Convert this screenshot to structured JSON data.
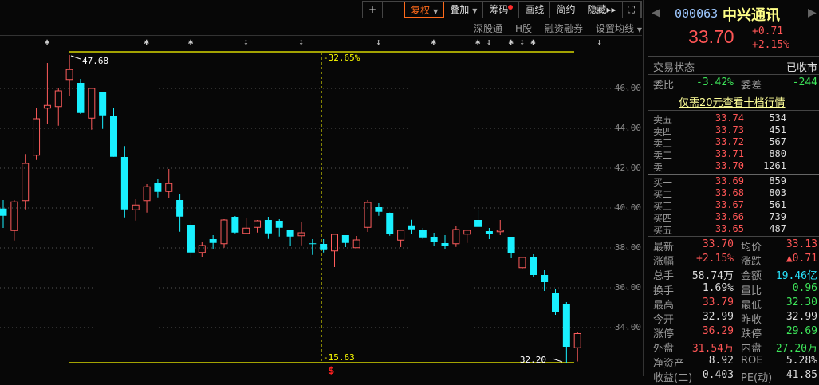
{
  "toolbar": {
    "zoom_in": "+",
    "zoom_out": "—",
    "restore_rights": "复权",
    "overlay": "叠加",
    "chips": "筹码",
    "draw": "画线",
    "simple": "简约",
    "hide": "隐藏",
    "hide_arrow": "▸▸",
    "fullscreen": "⛶"
  },
  "subbar": [
    "深股通",
    "H股",
    "融资融券",
    "设置均线"
  ],
  "events": [
    {
      "x_index": 2,
      "type": "star"
    },
    {
      "x_index": 11,
      "type": "star"
    },
    {
      "x_index": 15,
      "type": "star"
    },
    {
      "x_index": 20,
      "type": "info"
    },
    {
      "x_index": 25,
      "type": "info"
    },
    {
      "x_index": 32,
      "type": "info"
    },
    {
      "x_index": 37,
      "type": "star"
    },
    {
      "x_index": 41,
      "type": "star"
    },
    {
      "x_index": 42,
      "type": "info"
    },
    {
      "x_index": 44,
      "type": "star"
    },
    {
      "x_index": 45,
      "type": "info"
    },
    {
      "x_index": 46,
      "type": "star"
    },
    {
      "x_index": 52,
      "type": "info"
    }
  ],
  "chart_data": {
    "type": "candlestick",
    "ylim": [
      32.0,
      48.0
    ],
    "y_ticks": [
      "46.00",
      "44.00",
      "42.00",
      "40.00",
      "38.00",
      "36.00",
      "34.00"
    ],
    "colors": {
      "up": "#ff5c5c",
      "down": "#19f0ff",
      "range_line": "#ffff00"
    },
    "grid": "dotted horizontal",
    "max_label": "47.68",
    "min_label": "32.20",
    "range_top_label": "-32.65%",
    "range_bottom_label": "-15.63",
    "dividend_marker": "$",
    "ohlc": [
      [
        39.97,
        40.4,
        39.0,
        39.61
      ],
      [
        38.87,
        40.4,
        38.37,
        40.31
      ],
      [
        40.37,
        42.71,
        39.93,
        42.24
      ],
      [
        42.65,
        45.04,
        42.41,
        44.48
      ],
      [
        45.01,
        47.28,
        44.24,
        45.15
      ],
      [
        45.09,
        46.0,
        44.13,
        45.88
      ],
      [
        46.45,
        47.68,
        45.64,
        46.95
      ],
      [
        46.28,
        46.48,
        44.72,
        44.77
      ],
      [
        44.51,
        46.0,
        43.93,
        46.0
      ],
      [
        45.84,
        45.84,
        43.97,
        44.65
      ],
      [
        44.64,
        45.04,
        42.57,
        42.57
      ],
      [
        42.56,
        43.11,
        39.53,
        39.93
      ],
      [
        39.91,
        40.44,
        39.37,
        40.15
      ],
      [
        40.37,
        41.2,
        39.77,
        41.07
      ],
      [
        41.24,
        41.44,
        40.53,
        40.81
      ],
      [
        40.83,
        41.96,
        40.49,
        41.23
      ],
      [
        40.4,
        40.68,
        38.81,
        39.57
      ],
      [
        39.16,
        39.35,
        37.49,
        37.77
      ],
      [
        37.77,
        38.28,
        37.53,
        38.12
      ],
      [
        38.44,
        38.64,
        37.93,
        38.25
      ],
      [
        38.21,
        39.44,
        38.01,
        39.4
      ],
      [
        39.56,
        39.6,
        38.73,
        38.77
      ],
      [
        38.73,
        39.52,
        38.68,
        38.99
      ],
      [
        39.03,
        39.4,
        38.77,
        39.36
      ],
      [
        39.4,
        39.56,
        38.45,
        38.73
      ],
      [
        39.36,
        39.44,
        38.57,
        39.01
      ],
      [
        38.88,
        38.88,
        38.09,
        38.57
      ],
      [
        38.61,
        39.32,
        38.13,
        38.76
      ],
      [
        38.23,
        38.44,
        37.65,
        38.22
      ],
      [
        38.2,
        38.44,
        37.77,
        37.89
      ],
      [
        37.85,
        38.68,
        37.04,
        38.68
      ],
      [
        38.64,
        38.64,
        38.04,
        38.25
      ],
      [
        38.01,
        38.6,
        38.01,
        38.4
      ],
      [
        39.03,
        40.4,
        38.8,
        40.28
      ],
      [
        40.04,
        40.24,
        39.61,
        39.81
      ],
      [
        39.76,
        39.77,
        38.61,
        38.69
      ],
      [
        38.39,
        38.88,
        38.04,
        38.88
      ],
      [
        39.13,
        39.41,
        38.69,
        38.93
      ],
      [
        38.92,
        39.0,
        38.44,
        38.53
      ],
      [
        38.56,
        38.76,
        38.12,
        38.29
      ],
      [
        38.24,
        38.64,
        37.96,
        38.09
      ],
      [
        38.21,
        39.08,
        38.05,
        38.92
      ],
      [
        38.69,
        38.92,
        38.25,
        38.88
      ],
      [
        39.4,
        39.88,
        39.05,
        39.05
      ],
      [
        38.84,
        39.0,
        38.44,
        38.72
      ],
      [
        38.81,
        39.4,
        38.64,
        38.89
      ],
      [
        38.56,
        38.56,
        37.48,
        37.72
      ],
      [
        37.01,
        37.56,
        36.97,
        37.52
      ],
      [
        37.52,
        37.68,
        36.56,
        36.64
      ],
      [
        36.64,
        36.88,
        35.84,
        36.28
      ],
      [
        35.76,
        35.96,
        34.64,
        34.8
      ],
      [
        35.2,
        35.28,
        32.2,
        33.04
      ],
      [
        32.99,
        33.79,
        32.3,
        33.7
      ]
    ]
  },
  "panel": {
    "code": "000063",
    "name": "中兴通讯",
    "price": "33.70",
    "change": "+0.71",
    "change_pct": "+2.15%",
    "status_label": "交易状态",
    "status_value": "已收市",
    "ratio_label": "委比",
    "ratio_value": "-3.42%",
    "diff_label": "委差",
    "diff_value": "-244",
    "promo": "仅需20元查看十档行情",
    "asks": [
      {
        "label": "卖五",
        "price": "33.74",
        "vol": "534"
      },
      {
        "label": "卖四",
        "price": "33.73",
        "vol": "451"
      },
      {
        "label": "卖三",
        "price": "33.72",
        "vol": "567"
      },
      {
        "label": "卖二",
        "price": "33.71",
        "vol": "880"
      },
      {
        "label": "卖一",
        "price": "33.70",
        "vol": "1261"
      }
    ],
    "bids": [
      {
        "label": "买一",
        "price": "33.69",
        "vol": "859"
      },
      {
        "label": "买二",
        "price": "33.68",
        "vol": "803"
      },
      {
        "label": "买三",
        "price": "33.67",
        "vol": "561"
      },
      {
        "label": "买四",
        "price": "33.66",
        "vol": "739"
      },
      {
        "label": "买五",
        "price": "33.65",
        "vol": "487"
      }
    ],
    "stats": [
      [
        {
          "l": "最新",
          "v": "33.70",
          "c": "red"
        },
        {
          "l": "均价",
          "v": "33.13",
          "c": "red"
        }
      ],
      [
        {
          "l": "涨幅",
          "v": "+2.15%",
          "c": "red"
        },
        {
          "l": "涨跌",
          "v": "▲0.71",
          "c": "red"
        }
      ],
      [
        {
          "l": "总手",
          "v": "58.74万",
          "c": "white"
        },
        {
          "l": "金额",
          "v": "19.46亿",
          "c": "cyan"
        }
      ],
      [
        {
          "l": "换手",
          "v": "1.69%",
          "c": "white"
        },
        {
          "l": "量比",
          "v": "0.96",
          "c": "green"
        }
      ],
      [
        {
          "l": "最高",
          "v": "33.79",
          "c": "red"
        },
        {
          "l": "最低",
          "v": "32.30",
          "c": "green"
        }
      ],
      [
        {
          "l": "今开",
          "v": "32.99",
          "c": "white"
        },
        {
          "l": "昨收",
          "v": "32.99",
          "c": "white"
        }
      ],
      [
        {
          "l": "涨停",
          "v": "36.29",
          "c": "red"
        },
        {
          "l": "跌停",
          "v": "29.69",
          "c": "green"
        }
      ],
      [
        {
          "l": "外盘",
          "v": "31.54万",
          "c": "red"
        },
        {
          "l": "内盘",
          "v": "27.20万",
          "c": "green"
        }
      ],
      [
        {
          "l": "净资产",
          "v": "8.92",
          "c": "white"
        },
        {
          "l": "ROE",
          "v": "5.28%",
          "c": "white"
        }
      ],
      [
        {
          "l": "收益(二)",
          "v": "0.403",
          "c": "white"
        },
        {
          "l": "PE(动)",
          "v": "41.85",
          "c": "white"
        }
      ]
    ]
  }
}
